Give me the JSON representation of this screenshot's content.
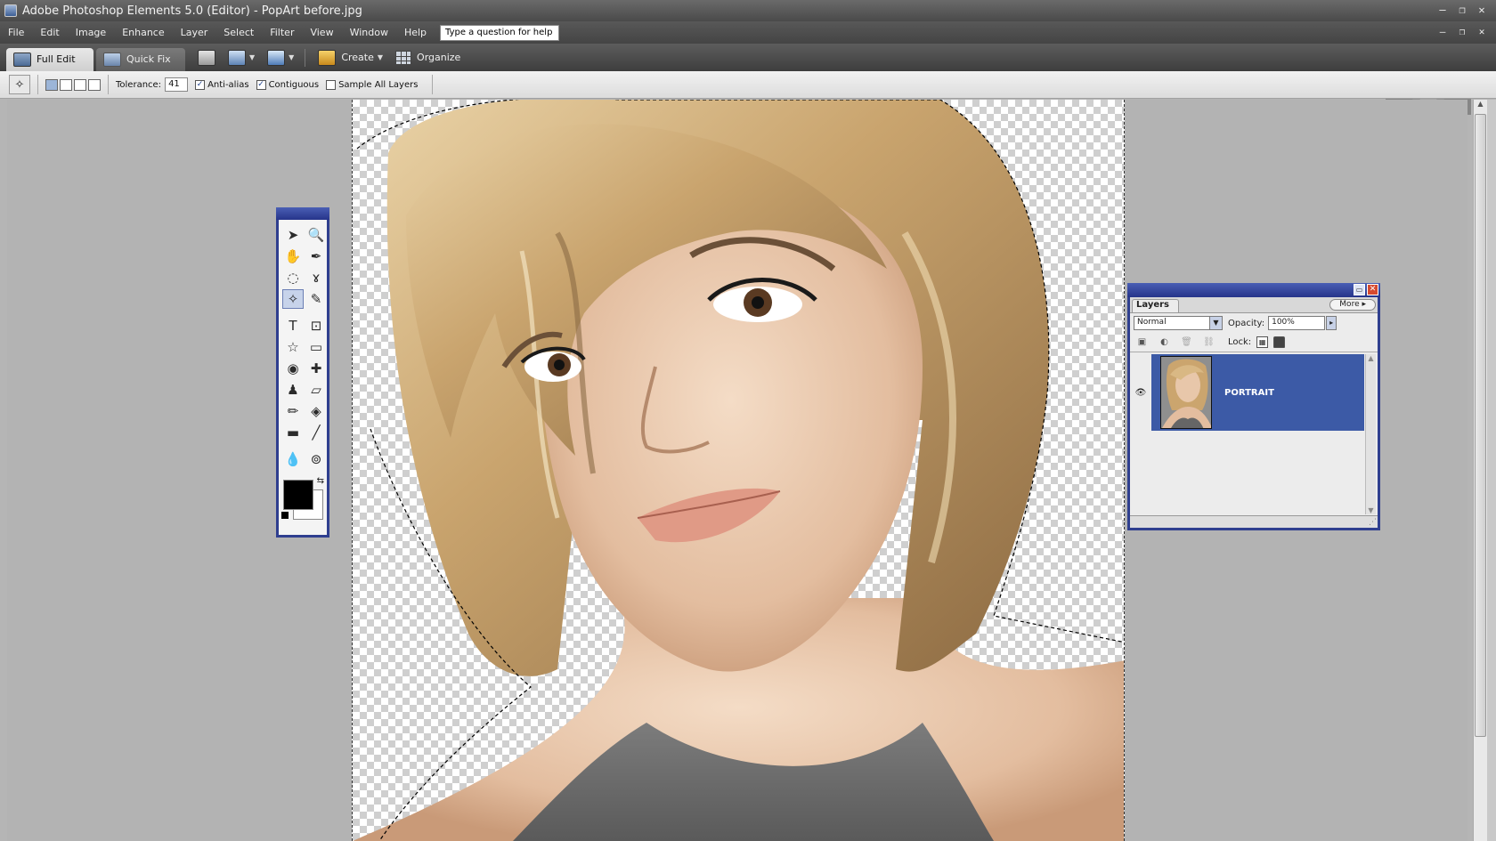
{
  "window": {
    "title": "Adobe Photoshop Elements 5.0 (Editor) - PopArt before.jpg",
    "controls": [
      "–",
      "❐",
      "✕"
    ]
  },
  "menubar": {
    "items": [
      "File",
      "Edit",
      "Image",
      "Enhance",
      "Layer",
      "Select",
      "Filter",
      "View",
      "Window",
      "Help"
    ],
    "help_placeholder": "Type a question for help",
    "doc_controls": [
      "–",
      "❐",
      "✕"
    ]
  },
  "shortcuts": {
    "full_edit": "Full Edit",
    "quick_fix": "Quick Fix",
    "create": "Create",
    "organize": "Organize"
  },
  "options": {
    "tolerance_label": "Tolerance:",
    "tolerance_value": "41",
    "anti_alias": "Anti-alias",
    "anti_alias_checked": true,
    "contiguous": "Contiguous",
    "contiguous_checked": true,
    "sample_all": "Sample All Layers",
    "sample_all_checked": false,
    "check_glyph": "✓"
  },
  "toolbox": {
    "tools": [
      {
        "name": "move-tool",
        "glyph": "➤"
      },
      {
        "name": "zoom-tool",
        "glyph": "🔍"
      },
      {
        "name": "hand-tool",
        "glyph": "✋"
      },
      {
        "name": "eyedropper-tool",
        "glyph": "✒"
      },
      {
        "name": "lasso-tool",
        "glyph": "◌"
      },
      {
        "name": "magnetic-lasso-tool",
        "glyph": "ɤ"
      },
      {
        "name": "magic-wand-tool",
        "glyph": "✧"
      },
      {
        "name": "brush-select-tool",
        "glyph": "✎"
      },
      {
        "name": "type-tool",
        "glyph": "T"
      },
      {
        "name": "crop-tool",
        "glyph": "⊡"
      },
      {
        "name": "shape-tool",
        "glyph": "☆"
      },
      {
        "name": "redeye-tool",
        "glyph": "▭"
      },
      {
        "name": "spot-heal-tool",
        "glyph": "◉"
      },
      {
        "name": "healing-tool",
        "glyph": "✚"
      },
      {
        "name": "clone-stamp-tool",
        "glyph": "♟"
      },
      {
        "name": "eraser-tool",
        "glyph": "▱"
      },
      {
        "name": "pencil-tool",
        "glyph": "✏"
      },
      {
        "name": "paint-bucket-tool",
        "glyph": "◈"
      },
      {
        "name": "gradient-tool",
        "glyph": "▬"
      },
      {
        "name": "line-tool",
        "glyph": "╱"
      },
      {
        "name": "blur-tool",
        "glyph": "💧"
      },
      {
        "name": "sponge-tool",
        "glyph": "⊚"
      }
    ],
    "active_tool": "magic-wand-tool",
    "foreground_color": "#000000",
    "background_color": "#ffffff"
  },
  "layers_palette": {
    "tab": "Layers",
    "more": "More",
    "blend_mode": "Normal",
    "opacity_label": "Opacity:",
    "opacity_value": "100%",
    "lock_label": "Lock:",
    "layer_name": "PORTRAIT",
    "layer_highlight_color": "#3c5aa6"
  },
  "colors": {
    "panel_border": "#2f3f8f",
    "title_gradient_top": "#4a5fb4",
    "workspace": "#b3b3b3"
  }
}
